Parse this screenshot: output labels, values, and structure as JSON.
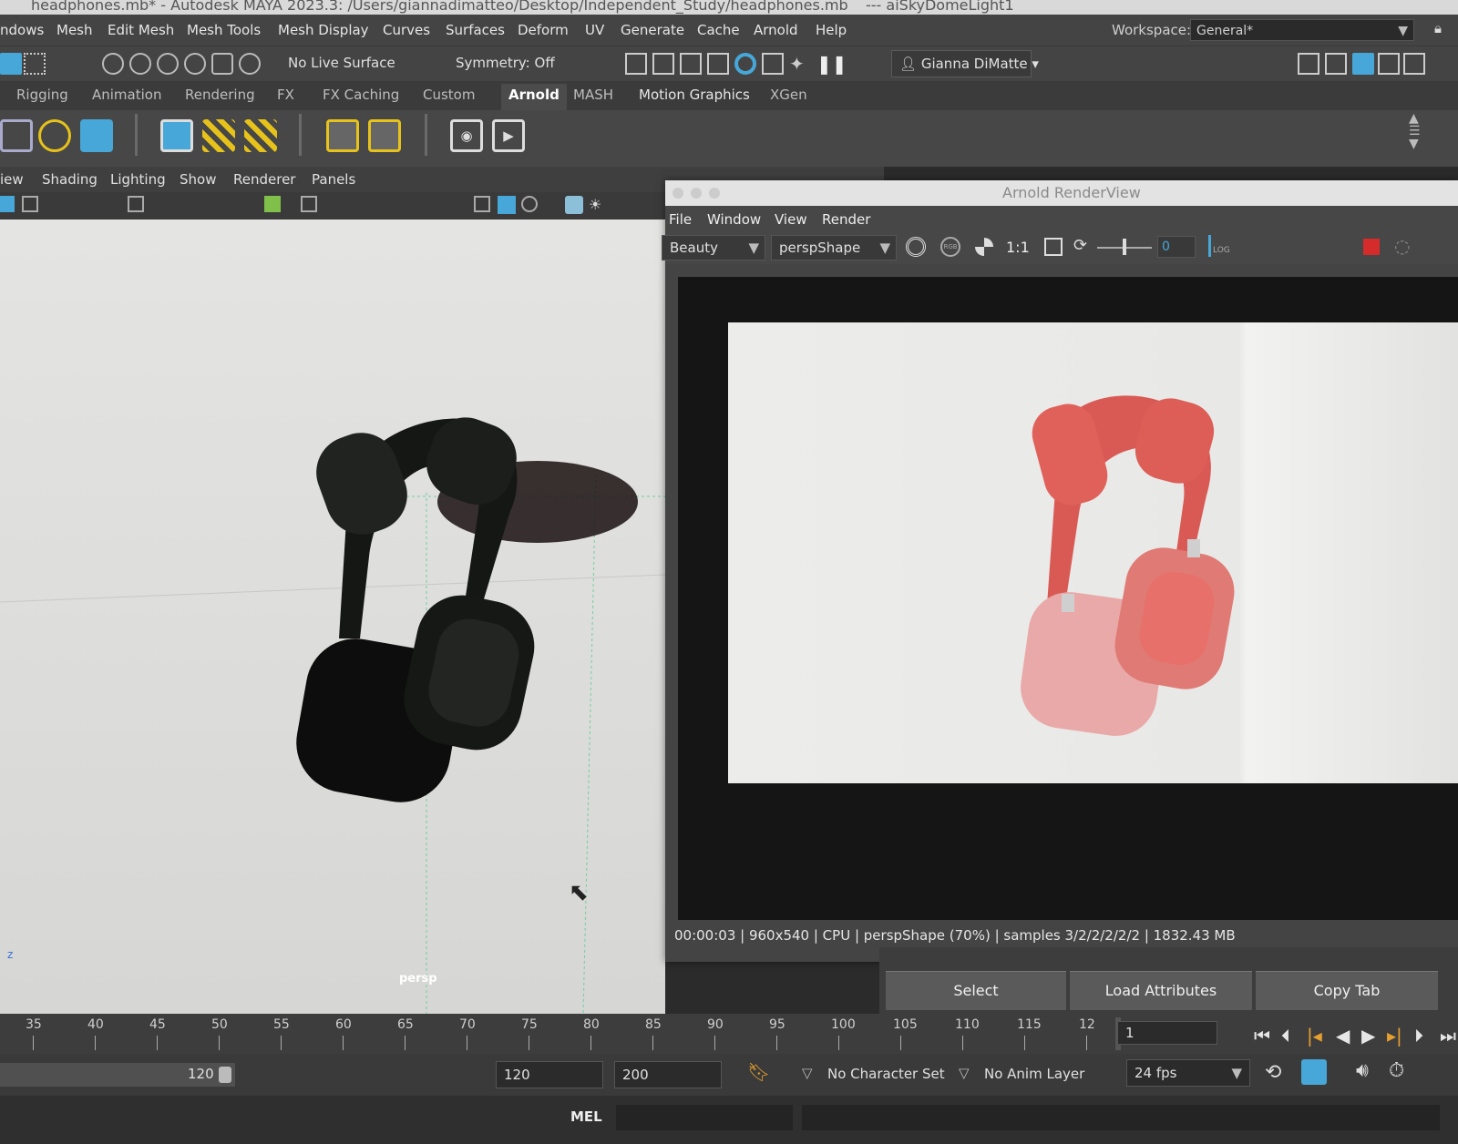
{
  "window": {
    "title": "headphones.mb* - Autodesk MAYA 2023.3: /Users/giannadimatteo/Desktop/Independent_Study/headphones.mb",
    "title_extra": "---   aiSkyDomeLight1"
  },
  "menubar": {
    "items": [
      "ndows",
      "Mesh",
      "Edit Mesh",
      "Mesh Tools",
      "Mesh Display",
      "Curves",
      "Surfaces",
      "Deform",
      "UV",
      "Generate",
      "Cache",
      "Arnold",
      "Help"
    ],
    "workspace_label": "Workspace:",
    "workspace_value": "General*"
  },
  "statusline": {
    "live_surface": "No Live Surface",
    "symmetry": "Symmetry: Off",
    "user": "Gianna DiMatte"
  },
  "shelf_tabs": {
    "items": [
      "Rigging",
      "Animation",
      "Rendering",
      "FX",
      "FX Caching",
      "Custom",
      "Arnold",
      "MASH",
      "Motion Graphics",
      "XGen"
    ],
    "active": "Arnold"
  },
  "viewport": {
    "menu": [
      "iew",
      "Shading",
      "Lighting",
      "Show",
      "Renderer",
      "Panels"
    ],
    "camera_label": "persp",
    "axis_label": "z"
  },
  "renderview": {
    "title": "Arnold RenderView",
    "menu": [
      "File",
      "Window",
      "View",
      "Render"
    ],
    "aov": "Beauty",
    "camera": "perspShape",
    "ratio": "1:1",
    "exposure": "0",
    "log_label": "LOG",
    "rgb_label": "RGB",
    "status": "00:00:03 |  960x540 | CPU | perspShape (70%) | samples 3/2/2/2/2/2 | 1832.43 MB"
  },
  "attribute_buttons": [
    "Select",
    "Load Attributes",
    "Copy Tab"
  ],
  "timeline": {
    "ticks": [
      "35",
      "40",
      "45",
      "50",
      "55",
      "60",
      "65",
      "70",
      "75",
      "80",
      "85",
      "90",
      "95",
      "100",
      "105",
      "110",
      "115",
      "12"
    ],
    "current_frame": "1"
  },
  "range": {
    "range_end_slider": "120",
    "end_time": "120",
    "anim_end": "200",
    "character_set": "No Character Set",
    "anim_layer": "No Anim Layer",
    "fps": "24 fps"
  },
  "cmdline": {
    "lang": "MEL"
  },
  "colors": {
    "accent_blue": "#46a7d8",
    "shelf_yellow": "#e6c21a",
    "stop_red": "#d62b2b",
    "headphone_red": "#e0615a",
    "headphone_pink": "#e9a9a8"
  }
}
